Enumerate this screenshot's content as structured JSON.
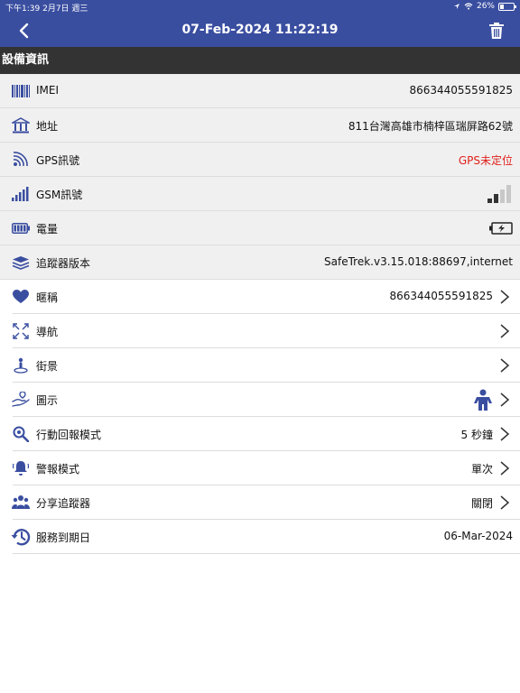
{
  "status_bar": {
    "time": "下午1:39",
    "date": "2月7日 週三",
    "battery": "26%",
    "battery_level": 0.26
  },
  "nav": {
    "title": "07-Feb-2024 11:22:19",
    "back_icon": "chevron-left-icon",
    "delete_icon": "trash-icon"
  },
  "section": {
    "title": "設備資訊"
  },
  "info_rows": [
    {
      "label": "IMEI",
      "value": "866344055591825",
      "icon": "barcode-icon"
    },
    {
      "label": "地址",
      "value": "811台灣高雄市楠梓區瑞屏路62號",
      "icon": "bank-icon"
    },
    {
      "label": "GPS訊號",
      "value": "GPS未定位",
      "value_color": "#e0201b",
      "icon": "gps-signal-icon"
    },
    {
      "label": "GSM訊號",
      "value": "",
      "icon": "gsm-signal-icon",
      "signal_level": 2,
      "signal_max": 4
    },
    {
      "label": "電量",
      "value": "",
      "icon": "battery-icon"
    },
    {
      "label": "追蹤器版本",
      "value": "SafeTrek.v3.15.018:88697,internet",
      "icon": "layers-icon"
    }
  ],
  "nav_rows": [
    {
      "label": "暱稱",
      "value": "866344055591825",
      "icon": "heart-icon"
    },
    {
      "label": "導航",
      "value": "",
      "icon": "navigation-arrows-icon"
    },
    {
      "label": "街景",
      "value": "",
      "icon": "street-view-icon"
    },
    {
      "label": "圖示",
      "value": "",
      "icon": "hand-icon"
    },
    {
      "label": "行動回報模式",
      "value": "5 秒鐘",
      "icon": "search-zoom-icon"
    },
    {
      "label": "警報模式",
      "value": "單次",
      "icon": "bell-icon"
    },
    {
      "label": "分享追蹤器",
      "value": "關閉",
      "icon": "users-icon"
    },
    {
      "label": "服務到期日",
      "value": "06-Mar-2024",
      "icon": "history-icon"
    }
  ],
  "colors": {
    "primary": "#3a4ea0",
    "icon_blue": "#3a4ea0",
    "section_bg": "#333333",
    "row_gray": "#f0f0f0"
  }
}
